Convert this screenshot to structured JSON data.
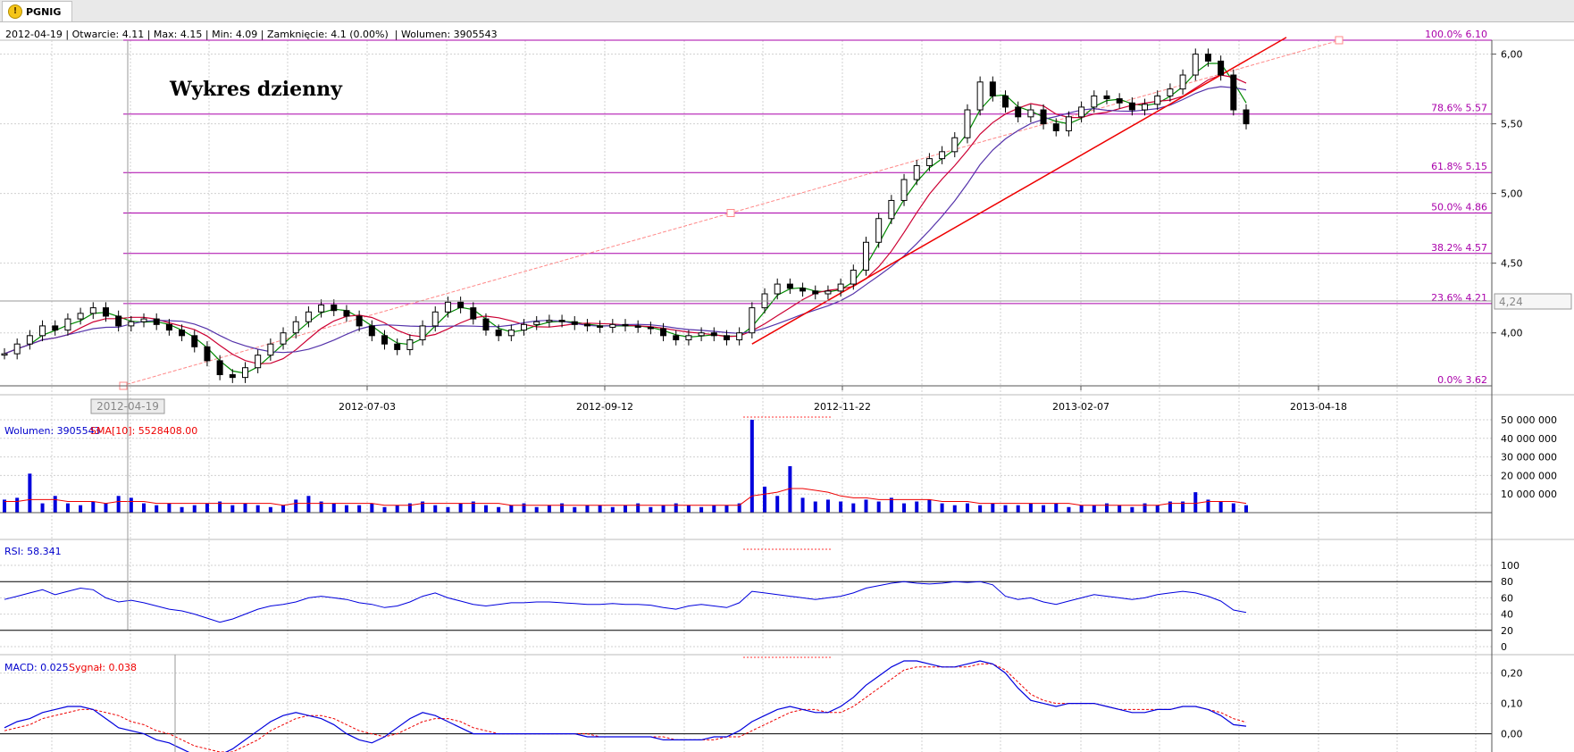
{
  "tab": {
    "title": "PGNIG",
    "icon": "warning-icon"
  },
  "info": {
    "date": "2012-04-19",
    "open_label": "Otwarcie:",
    "open": "4.11",
    "max_label": "Max:",
    "max": "4.15",
    "min_label": "Min:",
    "min": "4.09",
    "close_label": "Zamknięcie:",
    "close": "4.1 (0.00%)",
    "volume_label": "Wolumen:",
    "volume": "3905543"
  },
  "chart_title": "Wykres dzienny",
  "colors": {
    "candle": "#000000",
    "sma_short": "#008800",
    "sma_mid": "#cc0033",
    "sma_long": "#5533aa",
    "fib": "#aa00aa",
    "trend": "#ee0000",
    "volume": "#0000dd",
    "rsi": "#0000dd",
    "macd": "#0000dd",
    "signal": "#ee0000"
  },
  "chart_data": [
    {
      "type": "candlestick",
      "x_tick_labels": [
        "2012-07-03",
        "2012-09-12",
        "2012-11-22",
        "2013-02-07",
        "2013-04-18"
      ],
      "crosshair_date_label": "2012-04-19",
      "y_tick_labels": [
        "6,00",
        "5,50",
        "5,00",
        "4,50",
        "4,00"
      ],
      "ylim": [
        3.62,
        6.1
      ],
      "last_price_label": "4,24",
      "fibonacci_levels": [
        {
          "label": "100.0% 6.10",
          "value": 6.1
        },
        {
          "label": "78.6% 5.57",
          "value": 5.57
        },
        {
          "label": "61.8% 5.15",
          "value": 5.15
        },
        {
          "label": "50.0% 4.86",
          "value": 4.86
        },
        {
          "label": "38.2% 4.57",
          "value": 4.57
        },
        {
          "label": "23.6% 4.21",
          "value": 4.21
        },
        {
          "label": "0.0% 3.62",
          "value": 3.62
        }
      ],
      "close_series": [
        3.85,
        3.92,
        3.98,
        4.05,
        4.02,
        4.1,
        4.14,
        4.18,
        4.12,
        4.05,
        4.08,
        4.1,
        4.06,
        4.02,
        3.98,
        3.9,
        3.8,
        3.7,
        3.68,
        3.75,
        3.84,
        3.92,
        4.0,
        4.08,
        4.15,
        4.2,
        4.16,
        4.12,
        4.05,
        3.98,
        3.92,
        3.88,
        3.95,
        4.05,
        4.15,
        4.22,
        4.18,
        4.1,
        4.02,
        3.98,
        4.02,
        4.06,
        4.08,
        4.09,
        4.08,
        4.06,
        4.05,
        4.04,
        4.06,
        4.05,
        4.04,
        4.03,
        3.98,
        3.95,
        3.98,
        4.0,
        3.98,
        3.95,
        4.0,
        4.18,
        4.28,
        4.35,
        4.32,
        4.3,
        4.28,
        4.3,
        4.35,
        4.45,
        4.65,
        4.82,
        4.95,
        5.1,
        5.2,
        5.25,
        5.3,
        5.4,
        5.6,
        5.8,
        5.7,
        5.62,
        5.55,
        5.6,
        5.5,
        5.45,
        5.55,
        5.62,
        5.7,
        5.68,
        5.65,
        5.6,
        5.64,
        5.7,
        5.75,
        5.85,
        6.0,
        5.95,
        5.85,
        5.6,
        5.5
      ]
    },
    {
      "type": "bar",
      "label": "Wolumen:",
      "value": "3905543",
      "sma_label": "SMA[10]:",
      "sma_value": "5528408.00",
      "y_tick_labels": [
        "50 000 000",
        "40 000 000",
        "30 000 000",
        "20 000 000",
        "10 000 000"
      ],
      "ylim": [
        0,
        50000000
      ],
      "values_millions": [
        7,
        8,
        21,
        5,
        9,
        5,
        4,
        6,
        5,
        9,
        8,
        5,
        4,
        5,
        3,
        4,
        5,
        6,
        4,
        5,
        4,
        3,
        4,
        7,
        9,
        6,
        5,
        4,
        4,
        5,
        3,
        4,
        5,
        6,
        4,
        3,
        5,
        6,
        4,
        3,
        4,
        5,
        3,
        4,
        5,
        3,
        4,
        4,
        3,
        4,
        5,
        3,
        4,
        5,
        4,
        3,
        4,
        4,
        5,
        50,
        14,
        9,
        25,
        8,
        6,
        7,
        6,
        5,
        7,
        6,
        8,
        5,
        6,
        7,
        5,
        4,
        5,
        4,
        5,
        4,
        4,
        5,
        4,
        5,
        3,
        4,
        4,
        5,
        4,
        3,
        5,
        4,
        6,
        6,
        11,
        7,
        6,
        5,
        4
      ],
      "sma_millions": [
        6,
        6,
        7,
        7,
        7,
        6,
        6,
        6,
        5,
        6,
        6,
        6,
        5,
        5,
        5,
        5,
        5,
        5,
        5,
        5,
        5,
        5,
        4,
        5,
        5,
        5,
        5,
        5,
        5,
        5,
        4,
        4,
        4,
        5,
        5,
        5,
        5,
        5,
        5,
        5,
        4,
        4,
        4,
        4,
        4,
        4,
        4,
        4,
        4,
        4,
        4,
        4,
        4,
        4,
        4,
        4,
        4,
        4,
        4,
        9,
        10,
        11,
        13,
        13,
        12,
        11,
        9,
        8,
        8,
        7,
        7,
        7,
        7,
        7,
        6,
        6,
        6,
        5,
        5,
        5,
        5,
        5,
        5,
        5,
        5,
        4,
        4,
        4,
        4,
        4,
        4,
        4,
        5,
        5,
        5,
        6,
        6,
        6,
        5
      ]
    },
    {
      "type": "line",
      "label": "RSI:",
      "value": "58.341",
      "y_tick_labels": [
        "100",
        "80",
        "60",
        "40",
        "20",
        "0"
      ],
      "ylim": [
        0,
        100
      ],
      "values": [
        58,
        62,
        66,
        70,
        64,
        68,
        72,
        70,
        60,
        55,
        57,
        54,
        50,
        46,
        44,
        40,
        35,
        30,
        34,
        40,
        46,
        50,
        52,
        55,
        60,
        62,
        60,
        58,
        54,
        52,
        48,
        50,
        55,
        62,
        66,
        60,
        56,
        52,
        50,
        52,
        54,
        54,
        55,
        55,
        54,
        53,
        52,
        52,
        53,
        52,
        52,
        51,
        48,
        46,
        50,
        52,
        50,
        48,
        54,
        68,
        66,
        64,
        62,
        60,
        58,
        60,
        62,
        66,
        72,
        75,
        78,
        80,
        78,
        77,
        78,
        80,
        79,
        80,
        76,
        62,
        58,
        60,
        55,
        52,
        56,
        60,
        64,
        62,
        60,
        58,
        60,
        64,
        66,
        68,
        66,
        62,
        56,
        45,
        42
      ]
    },
    {
      "type": "line",
      "label": "MACD:",
      "value": "0.025",
      "signal_label": "Sygnał:",
      "signal_value": "0.038",
      "y_tick_labels": [
        "0,20",
        "0,10",
        "0,00"
      ],
      "ylim": [
        -0.06,
        0.24
      ],
      "macd": [
        0.02,
        0.04,
        0.05,
        0.07,
        0.08,
        0.09,
        0.09,
        0.08,
        0.05,
        0.02,
        0.01,
        0.0,
        -0.02,
        -0.03,
        -0.05,
        -0.07,
        -0.08,
        -0.07,
        -0.05,
        -0.02,
        0.01,
        0.04,
        0.06,
        0.07,
        0.06,
        0.05,
        0.03,
        0.0,
        -0.02,
        -0.03,
        -0.01,
        0.02,
        0.05,
        0.07,
        0.06,
        0.04,
        0.02,
        0.0,
        0.0,
        0.0,
        0.0,
        0.0,
        0.0,
        0.0,
        0.0,
        0.0,
        -0.01,
        -0.01,
        -0.01,
        -0.01,
        -0.01,
        -0.01,
        -0.02,
        -0.02,
        -0.02,
        -0.02,
        -0.01,
        -0.01,
        0.01,
        0.04,
        0.06,
        0.08,
        0.09,
        0.08,
        0.07,
        0.07,
        0.09,
        0.12,
        0.16,
        0.19,
        0.22,
        0.24,
        0.24,
        0.23,
        0.22,
        0.22,
        0.23,
        0.24,
        0.23,
        0.2,
        0.15,
        0.11,
        0.1,
        0.09,
        0.1,
        0.1,
        0.1,
        0.09,
        0.08,
        0.07,
        0.07,
        0.08,
        0.08,
        0.09,
        0.09,
        0.08,
        0.06,
        0.03,
        0.025
      ],
      "signal": [
        0.01,
        0.02,
        0.03,
        0.05,
        0.06,
        0.07,
        0.08,
        0.08,
        0.07,
        0.06,
        0.04,
        0.03,
        0.01,
        0.0,
        -0.02,
        -0.04,
        -0.05,
        -0.06,
        -0.06,
        -0.04,
        -0.02,
        0.01,
        0.03,
        0.05,
        0.06,
        0.06,
        0.05,
        0.03,
        0.01,
        0.0,
        -0.01,
        0.0,
        0.02,
        0.04,
        0.05,
        0.05,
        0.04,
        0.02,
        0.01,
        0.0,
        0.0,
        0.0,
        0.0,
        0.0,
        0.0,
        0.0,
        0.0,
        -0.01,
        -0.01,
        -0.01,
        -0.01,
        -0.01,
        -0.01,
        -0.02,
        -0.02,
        -0.02,
        -0.02,
        -0.01,
        -0.01,
        0.01,
        0.03,
        0.05,
        0.07,
        0.08,
        0.08,
        0.07,
        0.07,
        0.09,
        0.12,
        0.15,
        0.18,
        0.21,
        0.22,
        0.22,
        0.22,
        0.22,
        0.22,
        0.23,
        0.23,
        0.21,
        0.17,
        0.13,
        0.11,
        0.1,
        0.1,
        0.1,
        0.1,
        0.09,
        0.08,
        0.08,
        0.08,
        0.08,
        0.08,
        0.09,
        0.09,
        0.08,
        0.07,
        0.05,
        0.038
      ]
    }
  ]
}
